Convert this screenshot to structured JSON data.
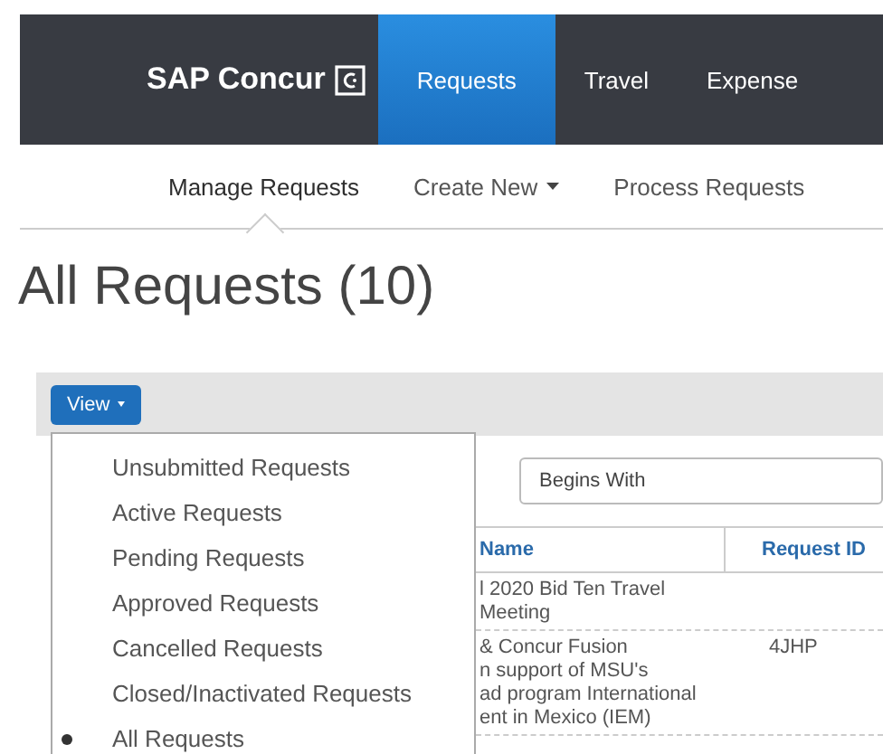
{
  "header": {
    "logo": "SAP Concur",
    "tabs": [
      {
        "label": "Requests",
        "selected": true
      },
      {
        "label": "Travel",
        "selected": false
      },
      {
        "label": "Expense",
        "selected": false
      }
    ]
  },
  "subnav": [
    {
      "label": "Manage Requests",
      "selected": true,
      "dropdown": false
    },
    {
      "label": "Create New",
      "selected": false,
      "dropdown": true
    },
    {
      "label": "Process Requests",
      "selected": false,
      "dropdown": false
    }
  ],
  "title": "All Requests (10)",
  "toolbar": {
    "view_button": "View"
  },
  "view_menu": [
    {
      "label": "Unsubmitted Requests",
      "selected": false
    },
    {
      "label": "Active Requests",
      "selected": false
    },
    {
      "label": "Pending Requests",
      "selected": false
    },
    {
      "label": "Approved Requests",
      "selected": false
    },
    {
      "label": "Cancelled Requests",
      "selected": false
    },
    {
      "label": "Closed/Inactivated Requests",
      "selected": false
    },
    {
      "label": "All Requests",
      "selected": true
    }
  ],
  "filter": {
    "value": "Begins With"
  },
  "table": {
    "columns": [
      "Name",
      "Request ID"
    ],
    "rows": [
      {
        "name_lines": [
          "l 2020 Bid Ten Travel",
          "Meeting"
        ]
      },
      {
        "name_lines": [
          "& Concur Fusion",
          "n support of MSU's",
          "ad program International",
          "ent in Mexico (IEM)"
        ],
        "request_id": "4JHP"
      }
    ]
  }
}
